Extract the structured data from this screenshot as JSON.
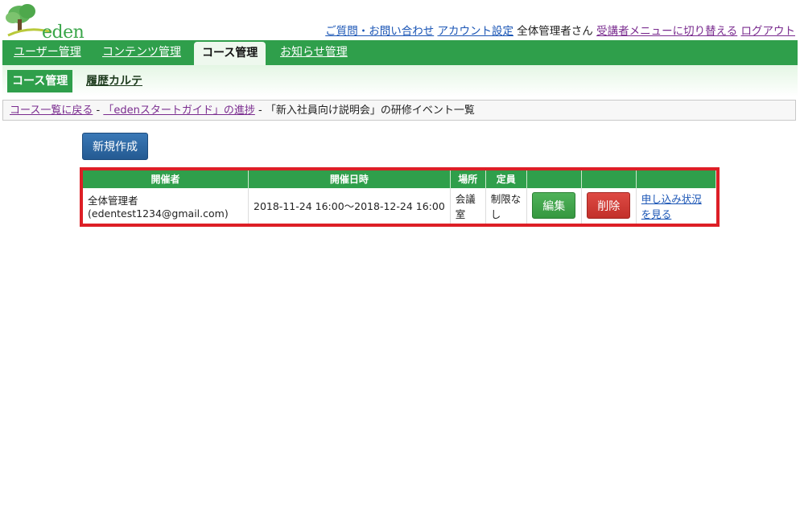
{
  "logo": {
    "text": "eden"
  },
  "header": {
    "contact_link": "ご質問・お問い合わせ",
    "account_link": "アカウント設定",
    "user_name": "全体管理者さん",
    "switch_link": "受講者メニューに切り替える",
    "logout_link": "ログアウト"
  },
  "mainnav": {
    "tabs": [
      {
        "label": "ユーザー管理"
      },
      {
        "label": "コンテンツ管理"
      },
      {
        "label": "コース管理"
      },
      {
        "label": "お知らせ管理"
      }
    ],
    "active": "コース管理"
  },
  "subnav": {
    "active_label": "コース管理",
    "link_label": "履歴カルテ"
  },
  "breadcrumb": {
    "back_link": "コース一覧に戻る",
    "sep": "-",
    "progress_link": "「edenスタートガイド」の進捗",
    "current": "「新入社員向け説明会」の研修イベント一覧"
  },
  "actions": {
    "new_label": "新規作成"
  },
  "table": {
    "headers": [
      "開催者",
      "開催日時",
      "場所",
      "定員",
      "",
      "",
      ""
    ],
    "rows": [
      {
        "organizer_name": "全体管理者",
        "organizer_email": "(edentest1234@gmail.com)",
        "datetime": "2018-11-24 16:00～2018-12-24 16:00",
        "place": "会議室",
        "capacity": "制限なし",
        "edit_label": "編集",
        "delete_label": "削除",
        "status_link": "申し込み状況を見る"
      }
    ]
  },
  "colors": {
    "brand_green": "#2f9f4b",
    "highlight_red": "#dd1f26",
    "primary_blue": "#2d6aa5"
  }
}
